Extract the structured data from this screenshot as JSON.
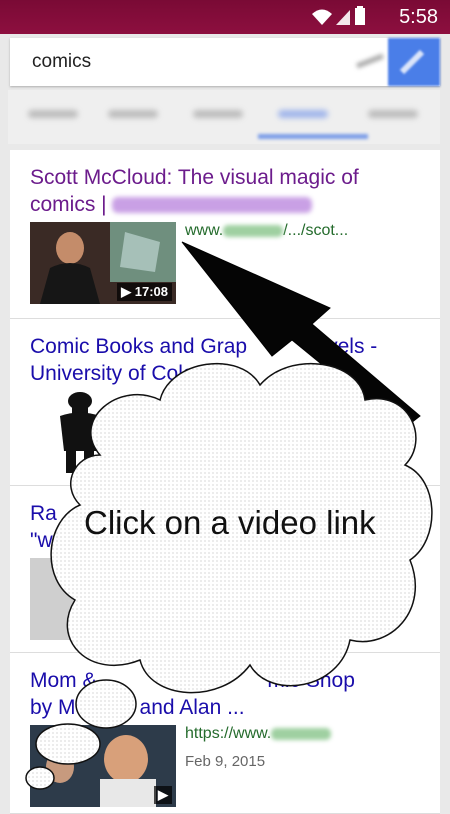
{
  "statusbar": {
    "time": "5:58",
    "wifi_icon": "wifi-icon",
    "signal_icon": "signal-icon",
    "battery_icon": "battery-icon"
  },
  "search": {
    "query": "comics",
    "mic_icon": "mic-icon",
    "search_icon": "search-icon"
  },
  "results": [
    {
      "title_line1": "Scott McCloud: The visual magic of",
      "title_line2": "comics |",
      "url": "www.",
      "url_tail": "/.../scot...",
      "duration": "17:08",
      "visited": true
    },
    {
      "title_line1": "Comic Books and Grap",
      "title_line1_tail": "vels -",
      "title_line2": "University of Colorado"
    },
    {
      "title_line1": "Ra",
      "title_line2": "\"w"
    },
    {
      "title_line1": "Mom & ",
      "title_line1_tail": "mic Shop",
      "title_line2": "by M",
      "title_line2_tail": "and Alan ...",
      "url": "https://www.",
      "date": "Feb 9, 2015"
    }
  ],
  "callout": {
    "text": "Click on a video link"
  },
  "colors": {
    "status_bar": "#8d0f3f",
    "link": "#1a0dab",
    "visited_link": "#6c1c8c",
    "url_green": "#246b2c"
  }
}
